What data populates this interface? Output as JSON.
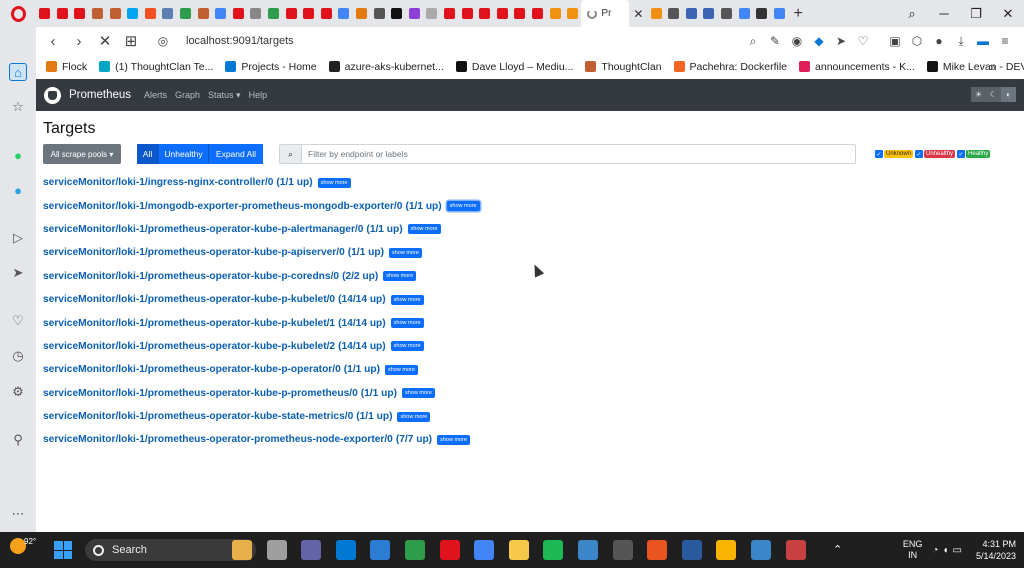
{
  "browser": {
    "active_tab_title": "Pr",
    "url": "localhost:9091/targets",
    "tab_icons": [
      "#e0131d",
      "#e0131d",
      "#e0131d",
      "#c06030",
      "#c06030",
      "#00a4ef",
      "#f25022",
      "#5a7fb0",
      "#2e9c4a",
      "#c06030",
      "#4285f4",
      "#e0131d",
      "#888888",
      "#2e9c4a",
      "#e0131d",
      "#e0131d",
      "#e0131d",
      "#4285f4",
      "#e47911",
      "#555555",
      "#111111",
      "#8d3fd5",
      "#aaaaaa",
      "#e0131d",
      "#e0131d",
      "#e0131d",
      "#e0131d",
      "#e0131d",
      "#e0131d",
      "#f29111",
      "#f29111"
    ],
    "more_tab_icons": [
      "#f29111",
      "#555555",
      "#3d63b5",
      "#3d63b5",
      "#555555",
      "#4285f4",
      "#333333",
      "#4285f4"
    ],
    "window_controls": [
      "─",
      "❐",
      "✕"
    ],
    "bookmarks": [
      {
        "label": "Flock",
        "color": "#e47911"
      },
      {
        "label": "(1) ThoughtClan Te...",
        "color": "#00a7c4"
      },
      {
        "label": "Projects - Home",
        "color": "#0078d4"
      },
      {
        "label": "azure-aks-kubernet...",
        "color": "#222222"
      },
      {
        "label": "Dave Lloyd – Mediu...",
        "color": "#111111"
      },
      {
        "label": "ThoughtClan",
        "color": "#c06030"
      },
      {
        "label": "Pachehra: Dockerfile",
        "color": "#f26522"
      },
      {
        "label": "announcements - K...",
        "color": "#e01e5a"
      },
      {
        "label": "Mike Levan - DEV C...",
        "color": "#111111"
      }
    ],
    "bookmarks_more": "»"
  },
  "prometheus": {
    "brand": "Prometheus",
    "nav": [
      "Alerts",
      "Graph",
      "Status ▾",
      "Help"
    ]
  },
  "targets_page": {
    "title": "Targets",
    "scrape_pools_dropdown": "All scrape pools ▾",
    "filter_buttons": [
      "All",
      "Unhealthy",
      "Expand All"
    ],
    "search_placeholder": "Filter by endpoint or labels",
    "health_filters": [
      {
        "label": "Unknown",
        "color": "#ffc107",
        "text_color": "#212529"
      },
      {
        "label": "Unhealthy",
        "color": "#dc3545",
        "text_color": "#ffffff"
      },
      {
        "label": "Healthy",
        "color": "#28a745",
        "text_color": "#ffffff"
      }
    ],
    "show_more_label": "show more",
    "pools": [
      {
        "name": "serviceMonitor/loki-1/ingress-nginx-controller/0",
        "count": "(1/1 up)"
      },
      {
        "name": "serviceMonitor/loki-1/mongodb-exporter-prometheus-mongodb-exporter/0",
        "count": "(1/1 up)"
      },
      {
        "name": "serviceMonitor/loki-1/prometheus-operator-kube-p-alertmanager/0",
        "count": "(1/1 up)"
      },
      {
        "name": "serviceMonitor/loki-1/prometheus-operator-kube-p-apiserver/0",
        "count": "(1/1 up)"
      },
      {
        "name": "serviceMonitor/loki-1/prometheus-operator-kube-p-coredns/0",
        "count": "(2/2 up)"
      },
      {
        "name": "serviceMonitor/loki-1/prometheus-operator-kube-p-kubelet/0",
        "count": "(14/14 up)"
      },
      {
        "name": "serviceMonitor/loki-1/prometheus-operator-kube-p-kubelet/1",
        "count": "(14/14 up)"
      },
      {
        "name": "serviceMonitor/loki-1/prometheus-operator-kube-p-kubelet/2",
        "count": "(14/14 up)"
      },
      {
        "name": "serviceMonitor/loki-1/prometheus-operator-kube-p-operator/0",
        "count": "(1/1 up)"
      },
      {
        "name": "serviceMonitor/loki-1/prometheus-operator-kube-p-prometheus/0",
        "count": "(1/1 up)"
      },
      {
        "name": "serviceMonitor/loki-1/prometheus-operator-kube-state-metrics/0",
        "count": "(1/1 up)"
      },
      {
        "name": "serviceMonitor/loki-1/prometheus-operator-prometheus-node-exporter/0",
        "count": "(7/7 up)"
      }
    ]
  },
  "taskbar": {
    "temperature": "92°",
    "search_label": "Search",
    "apps": [
      "#e8b04a",
      "#9e9e9e",
      "#6264a7",
      "#0078d4",
      "#2b7cd3",
      "#2e9c4a",
      "#e0131d",
      "#4285f4",
      "#f7c948",
      "#1db954",
      "#3a86c8",
      "#555555",
      "#e95420",
      "#2a5a9e",
      "#f7b500",
      "#3a86c8",
      "#c94040"
    ],
    "lang": [
      "ENG",
      "IN"
    ],
    "time": "4:31 PM",
    "date": "5/14/2023"
  }
}
